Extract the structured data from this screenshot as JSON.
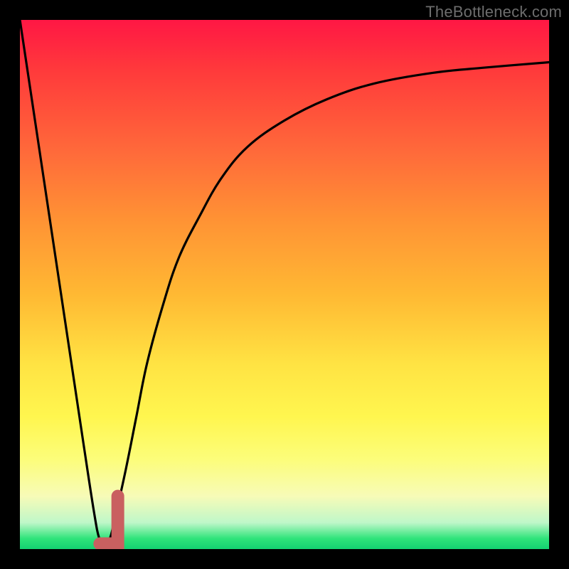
{
  "watermark": "TheBottleneck.com",
  "chart_data": {
    "type": "line",
    "title": "",
    "xlabel": "",
    "ylabel": "",
    "xlim": [
      0,
      100
    ],
    "ylim": [
      0,
      100
    ],
    "series": [
      {
        "name": "bottleneck-curve",
        "color": "#000000",
        "x": [
          0,
          3,
          6,
          9,
          12,
          14,
          15,
          16,
          17,
          18,
          20,
          22,
          24,
          27,
          30,
          34,
          38,
          43,
          50,
          58,
          67,
          78,
          88,
          100
        ],
        "values": [
          100,
          80,
          60,
          40,
          20,
          7,
          2,
          1,
          2,
          6,
          15,
          25,
          35,
          46,
          55,
          63,
          70,
          76,
          81,
          85,
          88,
          90,
          91,
          92
        ]
      }
    ],
    "marker": {
      "name": "highlight-range",
      "color": "#c96060",
      "x_start": 14.5,
      "x_end": 18.5,
      "y_start": 1,
      "y_end": 10
    },
    "background_gradient": {
      "top": "#ff1744",
      "middle": "#ffe343",
      "bottom": "#14d271"
    }
  }
}
